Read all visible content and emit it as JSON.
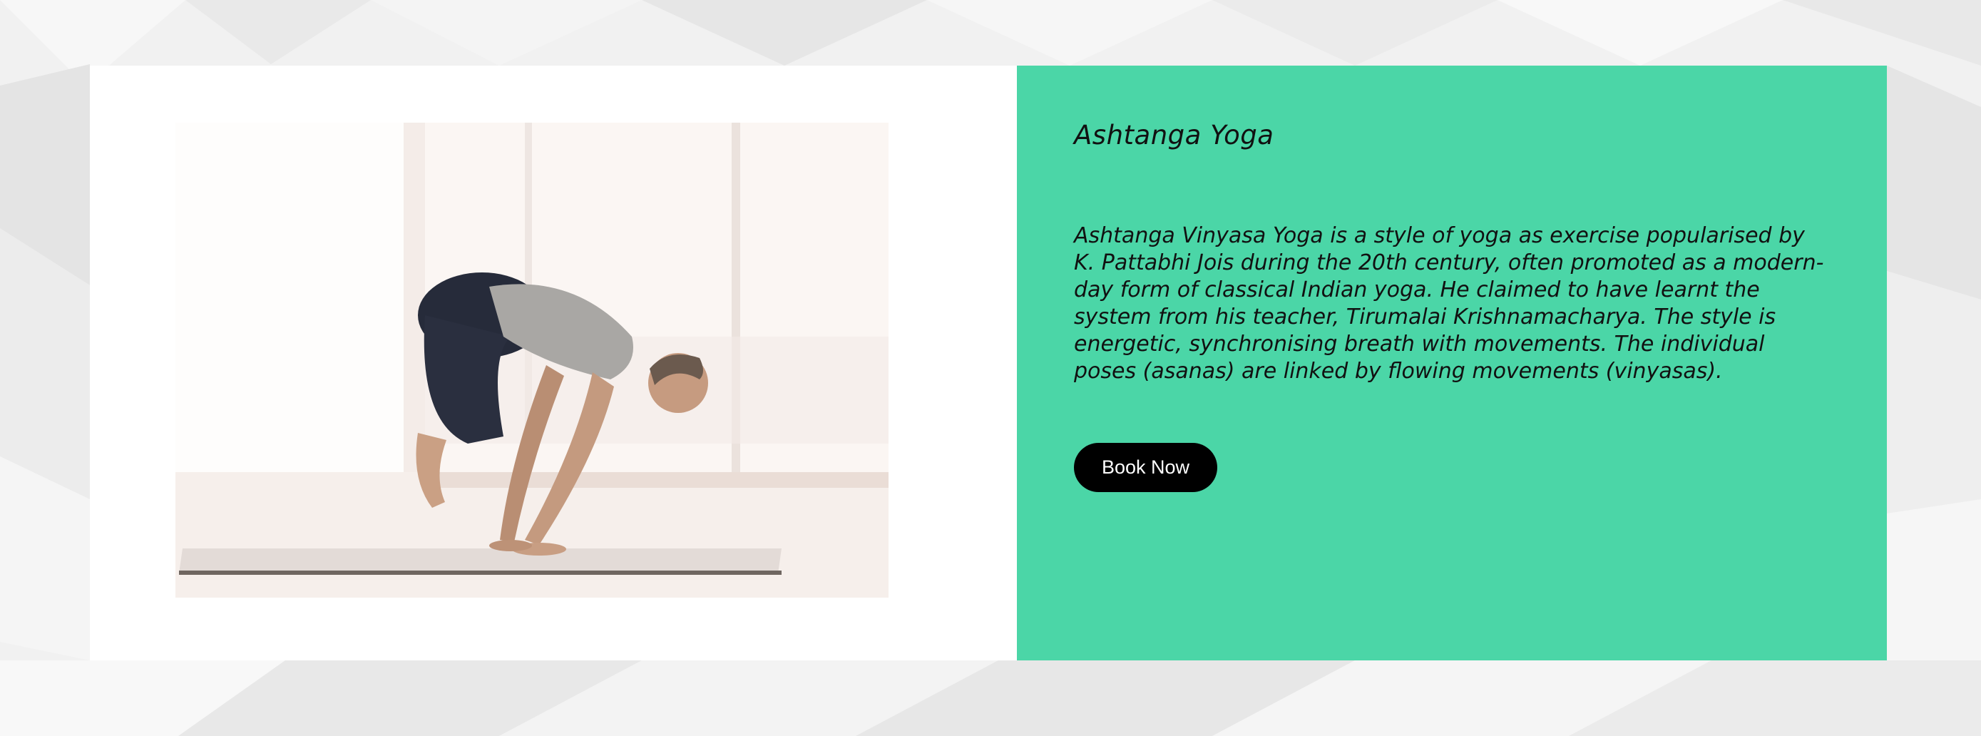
{
  "section": {
    "title": "Ashtanga Yoga",
    "description": "Ashtanga Vinyasa Yoga is a style of yoga as exercise popularised by K. Pattabhi Jois during the 20th century, often promoted as a modern-day form of classical Indian yoga. He claimed to have learnt the system from his teacher, Tirumalai Krishnamacharya. The style is energetic, synchronising breath with movements. The individual poses (asanas) are linked by flowing movements (vinyasas).",
    "book_button_label": "Book Now",
    "image_subject": "man-in-crow-pose-photo"
  },
  "colors": {
    "panel_background": "#4bd6a7",
    "card_background": "#ffffff",
    "button_background": "#000000",
    "button_text": "#ffffff",
    "page_background": "#eeeeee"
  }
}
